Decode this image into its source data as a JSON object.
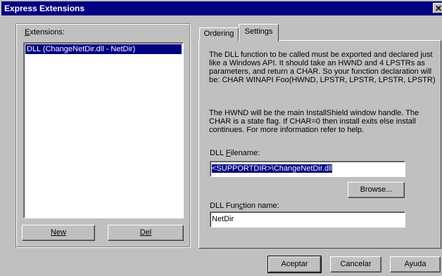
{
  "window": {
    "title": "Express Extensions",
    "close_glyph": "✕"
  },
  "extensions": {
    "label": "Extensions:",
    "items": [
      "DLL (ChangeNetDir.dll - NetDir)"
    ],
    "new_button": "New",
    "del_button": "Del"
  },
  "tabs": [
    {
      "label": "Ordering",
      "active": false
    },
    {
      "label": "Settings",
      "active": true
    }
  ],
  "settings": {
    "description_1": "The DLL function to be called must be exported and declared just like a Windows API.  It should take an HWND and 4 LPSTRs as parameters, and return a CHAR.  So your function declaration will be: CHAR WINAPI Foo(HWND, LPSTR, LPSTR, LPSTR, LPSTR)",
    "description_2": "The HWND will be the main InstallShield window handle.  The CHAR is a state flag. If CHAR=0 then install exits else install continues.  For more information refer to help.",
    "dll_filename_label": "DLL Filename:",
    "dll_filename_value": "<SUPPORTDIR>\\ChangeNetDir.dll",
    "browse_button": "Browse...",
    "function_name_label": "DLL Function name:",
    "function_name_value": "NetDir"
  },
  "footer": {
    "ok_button": "Aceptar",
    "cancel_button": "Cancelar",
    "help_button": "Ayuda"
  },
  "colors": {
    "selection": "#000080",
    "face": "#c0c0c0",
    "title_bar": "#000080"
  }
}
